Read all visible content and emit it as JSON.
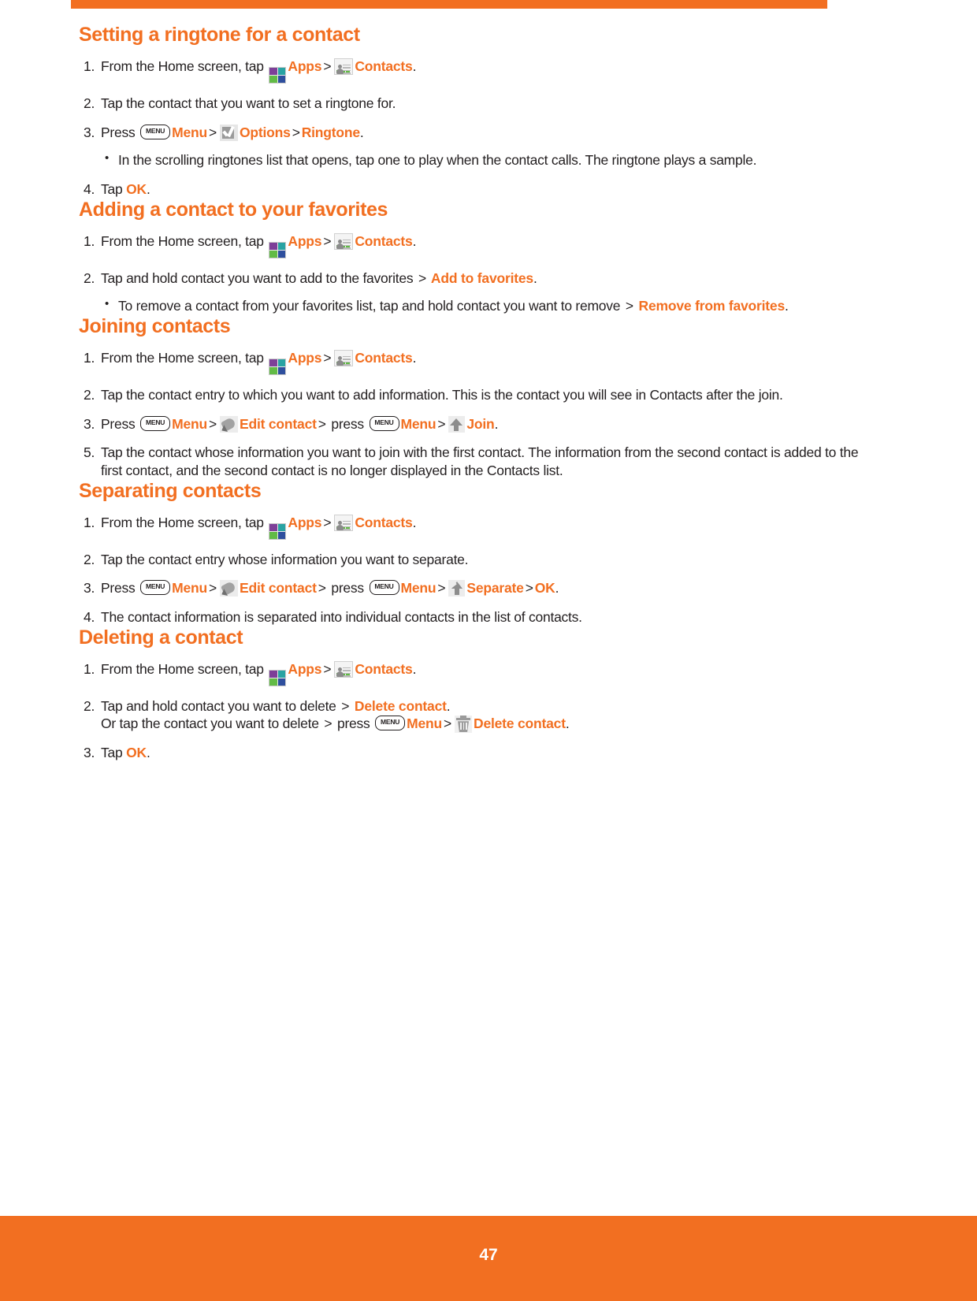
{
  "document": {
    "page_number": "47",
    "accent_color": "#F26F21",
    "text_color": "#231f20"
  },
  "icons": {
    "menu_key_label": "MENU"
  },
  "sections": [
    {
      "title": "Setting a ringtone for a contact",
      "steps": [
        {
          "num": "1.",
          "parts": [
            {
              "t": "text",
              "v": "From the Home screen, tap "
            },
            {
              "t": "icon",
              "v": "apps-icon"
            },
            {
              "t": "accent",
              "v": "Apps"
            },
            {
              "t": "gt",
              "v": ">"
            },
            {
              "t": "icon",
              "v": "contacts-icon"
            },
            {
              "t": "accent",
              "v": "Contacts"
            },
            {
              "t": "text",
              "v": "."
            }
          ]
        },
        {
          "num": "2.",
          "parts": [
            {
              "t": "text",
              "v": "Tap the contact that you want to set a ringtone for."
            }
          ]
        },
        {
          "num": "3.",
          "parts": [
            {
              "t": "text",
              "v": "Press "
            },
            {
              "t": "icon",
              "v": "menu-key-icon"
            },
            {
              "t": "accent",
              "v": "Menu"
            },
            {
              "t": "gt",
              "v": ">"
            },
            {
              "t": "icon",
              "v": "options-icon"
            },
            {
              "t": "accent",
              "v": "Options"
            },
            {
              "t": "gt",
              "v": ">"
            },
            {
              "t": "accent",
              "v": "Ringtone"
            },
            {
              "t": "text",
              "v": "."
            }
          ]
        },
        {
          "num": "bullet",
          "parts": [
            {
              "t": "text",
              "v": "In the scrolling ringtones list that opens, tap one to play when the contact calls. The ringtone plays a sample."
            }
          ]
        },
        {
          "num": "4.",
          "parts": [
            {
              "t": "text",
              "v": "Tap "
            },
            {
              "t": "accent",
              "v": "OK"
            },
            {
              "t": "text",
              "v": "."
            }
          ]
        }
      ]
    },
    {
      "title": "Adding a contact to your favorites",
      "steps": [
        {
          "num": "1.",
          "parts": [
            {
              "t": "text",
              "v": "From the Home screen, tap "
            },
            {
              "t": "icon",
              "v": "apps-icon"
            },
            {
              "t": "accent",
              "v": "Apps"
            },
            {
              "t": "gt",
              "v": ">"
            },
            {
              "t": "icon",
              "v": "contacts-icon"
            },
            {
              "t": "accent",
              "v": "Contacts"
            },
            {
              "t": "text",
              "v": "."
            }
          ]
        },
        {
          "num": "2.",
          "parts": [
            {
              "t": "text",
              "v": "Tap and hold contact you want to add to the favorites "
            },
            {
              "t": "gt",
              "v": ">"
            },
            {
              "t": "accent",
              "v": " Add to favorites"
            },
            {
              "t": "text",
              "v": "."
            }
          ]
        },
        {
          "num": "bullet",
          "parts": [
            {
              "t": "text",
              "v": "To remove a contact from your favorites list, tap and hold contact you want to remove "
            },
            {
              "t": "gt",
              "v": ">"
            },
            {
              "t": "accent",
              "v": " Remove from favorites"
            },
            {
              "t": "text",
              "v": "."
            }
          ]
        }
      ]
    },
    {
      "title": "Joining contacts",
      "steps": [
        {
          "num": "1.",
          "parts": [
            {
              "t": "text",
              "v": "From the Home screen, tap "
            },
            {
              "t": "icon",
              "v": "apps-icon"
            },
            {
              "t": "accent",
              "v": "Apps"
            },
            {
              "t": "gt",
              "v": ">"
            },
            {
              "t": "icon",
              "v": "contacts-icon"
            },
            {
              "t": "accent",
              "v": "Contacts"
            },
            {
              "t": "text",
              "v": "."
            }
          ]
        },
        {
          "num": "2.",
          "parts": [
            {
              "t": "text",
              "v": "Tap the contact entry to which you want to add information. This is the contact you will see in Contacts after the join."
            }
          ]
        },
        {
          "num": "3.",
          "parts": [
            {
              "t": "text",
              "v": "Press "
            },
            {
              "t": "icon",
              "v": "menu-key-icon"
            },
            {
              "t": "accent",
              "v": "Menu"
            },
            {
              "t": "gt",
              "v": ">"
            },
            {
              "t": "icon",
              "v": "edit-contact-icon"
            },
            {
              "t": "accent",
              "v": "Edit contact"
            },
            {
              "t": "gt",
              "v": ">"
            },
            {
              "t": "text",
              "v": " press "
            },
            {
              "t": "icon",
              "v": "menu-key-icon"
            },
            {
              "t": "accent",
              "v": "Menu"
            },
            {
              "t": "gt",
              "v": ">"
            },
            {
              "t": "icon",
              "v": "join-icon"
            },
            {
              "t": "accent",
              "v": "Join"
            },
            {
              "t": "text",
              "v": "."
            }
          ]
        },
        {
          "num": "5.",
          "parts": [
            {
              "t": "text",
              "v": "Tap the contact whose information you want to join with the first contact. The information from the second contact is added to the first contact, and the second contact is no longer displayed in the Contacts list."
            }
          ]
        }
      ]
    },
    {
      "title": "Separating contacts",
      "steps": [
        {
          "num": "1.",
          "parts": [
            {
              "t": "text",
              "v": "From the Home screen, tap "
            },
            {
              "t": "icon",
              "v": "apps-icon"
            },
            {
              "t": "accent",
              "v": "Apps"
            },
            {
              "t": "gt",
              "v": ">"
            },
            {
              "t": "icon",
              "v": "contacts-icon"
            },
            {
              "t": "accent",
              "v": "Contacts"
            },
            {
              "t": "text",
              "v": "."
            }
          ]
        },
        {
          "num": "2.",
          "parts": [
            {
              "t": "text",
              "v": "Tap the contact entry whose information you want to separate."
            }
          ]
        },
        {
          "num": "3.",
          "parts": [
            {
              "t": "text",
              "v": "Press "
            },
            {
              "t": "icon",
              "v": "menu-key-icon"
            },
            {
              "t": "accent",
              "v": "Menu"
            },
            {
              "t": "gt",
              "v": ">"
            },
            {
              "t": "icon",
              "v": "edit-contact-icon"
            },
            {
              "t": "accent",
              "v": "Edit contact"
            },
            {
              "t": "gt",
              "v": ">"
            },
            {
              "t": "text",
              "v": " press "
            },
            {
              "t": "icon",
              "v": "menu-key-icon"
            },
            {
              "t": "accent",
              "v": "Menu"
            },
            {
              "t": "gt",
              "v": ">"
            },
            {
              "t": "icon",
              "v": "separate-icon"
            },
            {
              "t": "accent",
              "v": "Separate"
            },
            {
              "t": "gt",
              "v": ">"
            },
            {
              "t": "accent",
              "v": "OK"
            },
            {
              "t": "text",
              "v": "."
            }
          ]
        },
        {
          "num": "4.",
          "parts": [
            {
              "t": "text",
              "v": "The contact information is separated into individual contacts in the list of contacts."
            }
          ]
        }
      ]
    },
    {
      "title": "Deleting a contact",
      "steps": [
        {
          "num": "1.",
          "parts": [
            {
              "t": "text",
              "v": "From the Home screen, tap "
            },
            {
              "t": "icon",
              "v": "apps-icon"
            },
            {
              "t": "accent",
              "v": "Apps"
            },
            {
              "t": "gt",
              "v": ">"
            },
            {
              "t": "icon",
              "v": "contacts-icon"
            },
            {
              "t": "accent",
              "v": "Contacts"
            },
            {
              "t": "text",
              "v": "."
            }
          ]
        },
        {
          "num": "2.",
          "parts": [
            {
              "t": "text",
              "v": "Tap and hold contact you want to delete "
            },
            {
              "t": "gt",
              "v": ">"
            },
            {
              "t": "accent",
              "v": " Delete contact"
            },
            {
              "t": "text",
              "v": "."
            },
            {
              "t": "br",
              "v": ""
            },
            {
              "t": "text",
              "v": "Or tap the contact you want  to delete "
            },
            {
              "t": "gt",
              "v": ">"
            },
            {
              "t": "text",
              "v": " press "
            },
            {
              "t": "icon",
              "v": "menu-key-icon"
            },
            {
              "t": "accent",
              "v": "Menu"
            },
            {
              "t": "gt",
              "v": ">"
            },
            {
              "t": "icon",
              "v": "trash-icon"
            },
            {
              "t": "accent",
              "v": "Delete contact"
            },
            {
              "t": "text",
              "v": "."
            }
          ]
        },
        {
          "num": "3.",
          "parts": [
            {
              "t": "text",
              "v": "Tap "
            },
            {
              "t": "accent",
              "v": "OK"
            },
            {
              "t": "text",
              "v": "."
            }
          ]
        }
      ]
    }
  ]
}
